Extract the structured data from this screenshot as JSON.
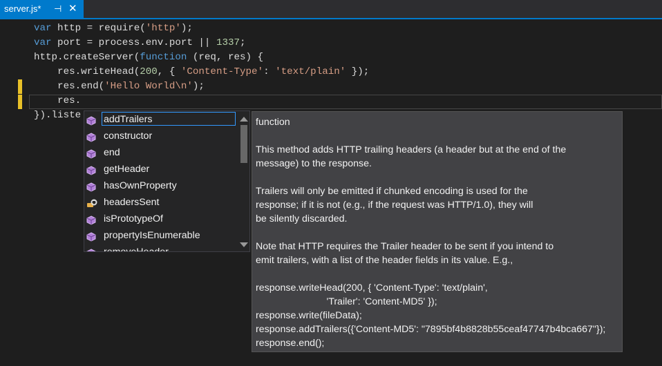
{
  "tab": {
    "title": "server.js*",
    "pin_glyph": "⊣",
    "close_glyph": "✕"
  },
  "code": {
    "line1": {
      "kw": "var",
      "a": " http = require(",
      "str": "'http'",
      "b": ");"
    },
    "line2": {
      "kw": "var",
      "a": " port = process.env.port || ",
      "num": "1337",
      "b": ";"
    },
    "line3": {
      "a": "http.createServer(",
      "kw": "function",
      "b": " (req, res) {"
    },
    "line4": {
      "a": "    res.writeHead(",
      "num": "200",
      "b": ", { ",
      "str1": "'Content-Type'",
      "c": ": ",
      "str2": "'text/plain'",
      "d": " });"
    },
    "line5": {
      "a": "    res.end(",
      "str": "'Hello World\\n'",
      "b": ");"
    },
    "line6": {
      "a": "    res."
    },
    "line7": {
      "a": "}).liste"
    }
  },
  "completion": {
    "items": [
      {
        "label": "addTrailers",
        "icon": "method-icon"
      },
      {
        "label": "constructor",
        "icon": "method-icon"
      },
      {
        "label": "end",
        "icon": "method-icon"
      },
      {
        "label": "getHeader",
        "icon": "method-icon"
      },
      {
        "label": "hasOwnProperty",
        "icon": "method-icon"
      },
      {
        "label": "headersSent",
        "icon": "property-icon"
      },
      {
        "label": "isPrototypeOf",
        "icon": "method-icon"
      },
      {
        "label": "propertyIsEnumerable",
        "icon": "method-icon"
      },
      {
        "label": "removeHeader",
        "icon": "method-icon"
      }
    ],
    "selected_index": 0
  },
  "tooltip": {
    "lines": [
      "function",
      "",
      "This method adds HTTP trailing headers (a header but at the end of the",
      "message) to the response.",
      "",
      "Trailers will only be emitted if chunked encoding is used for the",
      "response; if it is not (e.g., if the request was HTTP/1.0), they will",
      "be silently discarded.",
      "",
      "Note that HTTP requires the Trailer header to be sent if you intend to",
      "emit trailers, with a list of the header fields in its value. E.g.,",
      "",
      "response.writeHead(200, { 'Content-Type': 'text/plain',",
      "                          'Trailer': 'Content-MD5' });",
      "response.write(fileData);",
      "response.addTrailers({'Content-MD5': \"7895bf4b8828b55ceaf47747b4bca667\"});",
      "response.end();"
    ]
  },
  "colors": {
    "accent": "#007acc",
    "keyword": "#569cd6",
    "string": "#d69d85",
    "number": "#b5cea8",
    "method_icon": "#b180d7",
    "change_marker": "#e8c028"
  }
}
